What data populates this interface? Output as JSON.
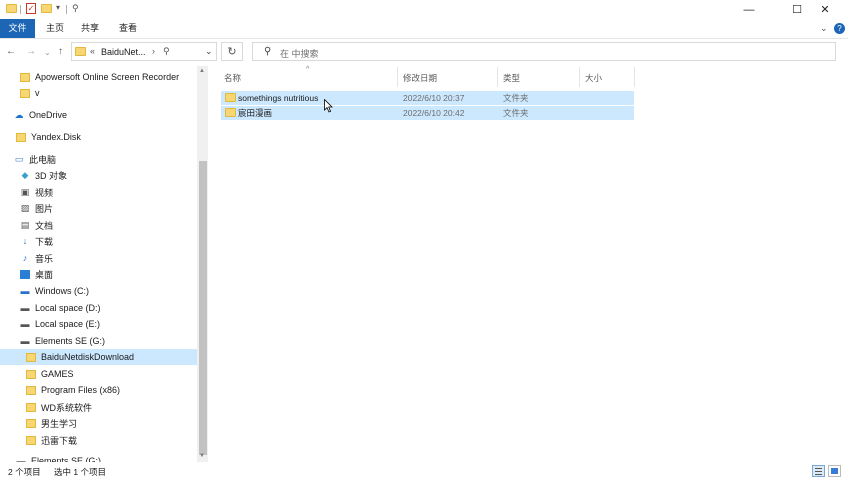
{
  "titlebar": {
    "title": "",
    "controls": {
      "minimize": "—",
      "maximize": "☐",
      "close": "✕"
    }
  },
  "ribbon": {
    "tabs": [
      "文件",
      "主页",
      "共享",
      "查看"
    ],
    "expand_icon": "chevron-down-icon",
    "help_icon": "help-icon",
    "help_text": "?"
  },
  "address": {
    "prefix": "«",
    "crumb": "BaiduNet...",
    "separator": "›"
  },
  "search": {
    "placeholder": "在 中搜索"
  },
  "sidebar": {
    "items": [
      {
        "label": "Apowersoft Online Screen Recorder",
        "icon": "folder-icon"
      },
      {
        "label": "v",
        "icon": "folder-icon"
      },
      {
        "label": "OneDrive",
        "icon": "cloud-icon"
      },
      {
        "label": "Yandex.Disk",
        "icon": "yandex-disk-icon"
      },
      {
        "label": "此电脑",
        "icon": "computer-icon"
      },
      {
        "label": "3D 对象",
        "icon": "cube-icon"
      },
      {
        "label": "视频",
        "icon": "video-icon"
      },
      {
        "label": "图片",
        "icon": "pictures-icon"
      },
      {
        "label": "文档",
        "icon": "document-icon"
      },
      {
        "label": "下载",
        "icon": "download-icon"
      },
      {
        "label": "音乐",
        "icon": "music-icon"
      },
      {
        "label": "桌面",
        "icon": "desktop-icon"
      },
      {
        "label": "Windows (C:)",
        "icon": "windows-drive-icon"
      },
      {
        "label": "Local space (D:)",
        "icon": "drive-icon"
      },
      {
        "label": "Local space (E:)",
        "icon": "drive-icon"
      },
      {
        "label": "Elements SE (G:)",
        "icon": "drive-icon"
      },
      {
        "label": "BaiduNetdiskDownload",
        "icon": "folder-icon",
        "selected": true
      },
      {
        "label": "GAMES",
        "icon": "folder-icon"
      },
      {
        "label": "Program Files (x86)",
        "icon": "folder-icon"
      },
      {
        "label": "WD系统软件",
        "icon": "folder-icon"
      },
      {
        "label": "男生学习",
        "icon": "folder-icon"
      },
      {
        "label": "迅雷下载",
        "icon": "folder-icon"
      },
      {
        "label": "Elements SE (G:)",
        "icon": "drive-icon"
      }
    ]
  },
  "columns": {
    "name": "名称",
    "date": "修改日期",
    "type": "类型",
    "size": "大小"
  },
  "files": [
    {
      "name": "somethings nutritious",
      "date": "2022/6/10 20:37",
      "type": "文件夹",
      "size": ""
    },
    {
      "name": "宸田漫画",
      "date": "2022/6/10 20:42",
      "type": "文件夹",
      "size": ""
    }
  ],
  "status": {
    "count": "2 个项目",
    "selected": "选中 1 个项目"
  },
  "colors": {
    "accent": "#1c66b5",
    "selection": "#cce8ff",
    "folder": "#f7d774"
  }
}
